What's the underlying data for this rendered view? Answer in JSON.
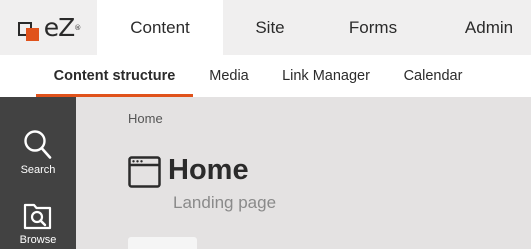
{
  "logo": {
    "text": "eZ",
    "tm": "®"
  },
  "main_tabs": [
    {
      "label": "Content",
      "active": true
    },
    {
      "label": "Site",
      "active": false
    },
    {
      "label": "Forms",
      "active": false
    },
    {
      "label": "Admin",
      "active": false
    }
  ],
  "sub_tabs": [
    {
      "label": "Content structure",
      "active": true
    },
    {
      "label": "Media",
      "active": false
    },
    {
      "label": "Link Manager",
      "active": false
    },
    {
      "label": "Calendar",
      "active": false
    }
  ],
  "rail": {
    "items": [
      {
        "label": "Search",
        "icon": "search-icon"
      },
      {
        "label": "Browse",
        "icon": "browse-icon"
      }
    ]
  },
  "breadcrumb": {
    "home": "Home"
  },
  "content": {
    "title": "Home",
    "subtitle": "Landing page",
    "icon": "landing-page-icon"
  },
  "colors": {
    "accent": "#e0521b",
    "rail_bg": "#424242",
    "content_bg": "#e4e2e2",
    "topbar_bg": "#f0efef"
  }
}
